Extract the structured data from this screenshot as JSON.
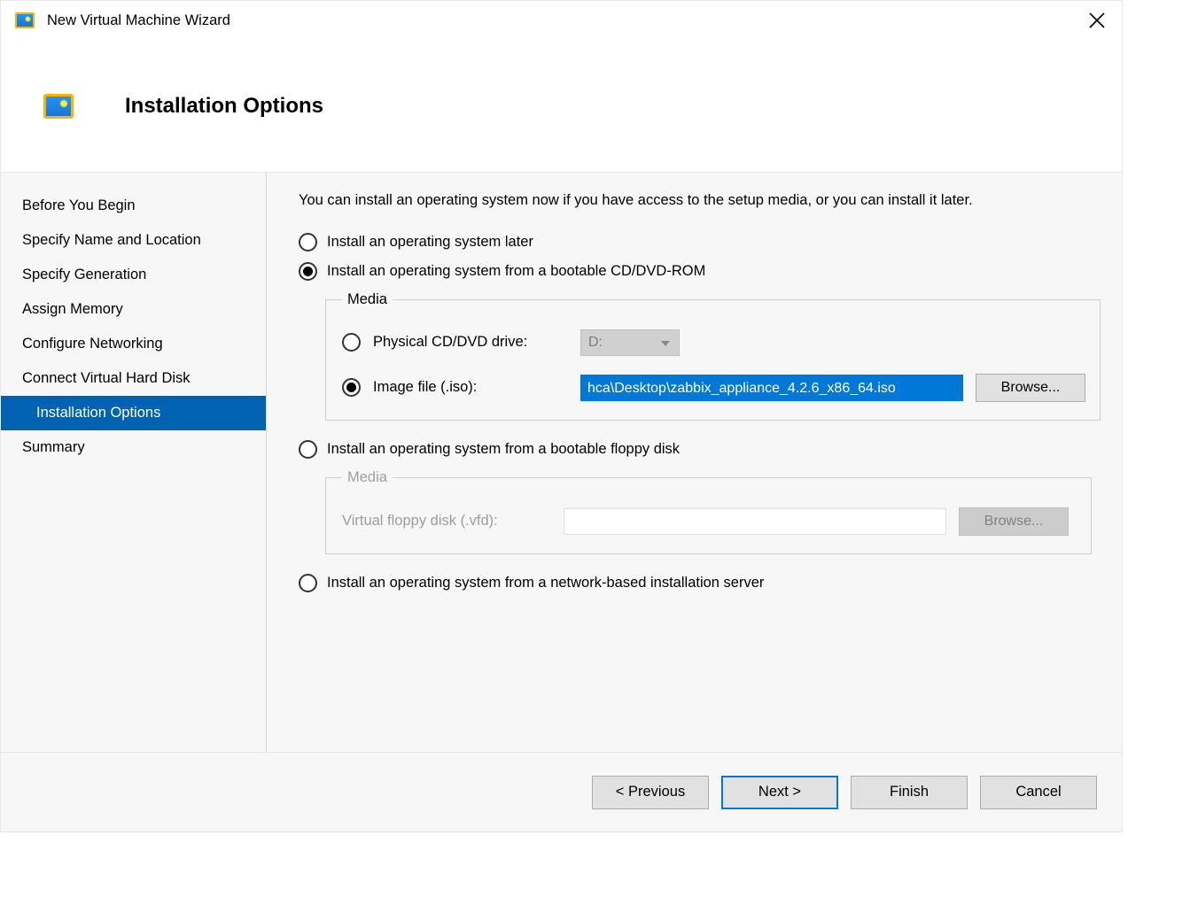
{
  "app": {
    "title": "New Virtual Machine Wizard"
  },
  "header": {
    "page_title": "Installation Options"
  },
  "sidebar": {
    "steps": [
      "Before You Begin",
      "Specify Name and Location",
      "Specify Generation",
      "Assign Memory",
      "Configure Networking",
      "Connect Virtual Hard Disk",
      "Installation Options",
      "Summary"
    ],
    "active_index": 6
  },
  "content": {
    "intro": "You can install an operating system now if you have access to the setup media, or you can install it later.",
    "opt_later": "Install an operating system later",
    "opt_bootcd": "Install an operating system from a bootable CD/DVD-ROM",
    "media_legend1": "Media",
    "physical": "Physical CD/DVD drive:",
    "drive_value": "D:",
    "imagefile": "Image file (.iso):",
    "iso_value": "hca\\Desktop\\zabbix_appliance_4.2.6_x86_64.iso",
    "browse": "Browse...",
    "opt_floppy": "Install an operating system from a bootable floppy disk",
    "media_legend2": "Media",
    "vfd_label": "Virtual floppy disk (.vfd):",
    "opt_network": "Install an operating system from a network-based installation server"
  },
  "footer": {
    "previous": "< Previous",
    "next": "Next >",
    "finish": "Finish",
    "cancel": "Cancel"
  }
}
